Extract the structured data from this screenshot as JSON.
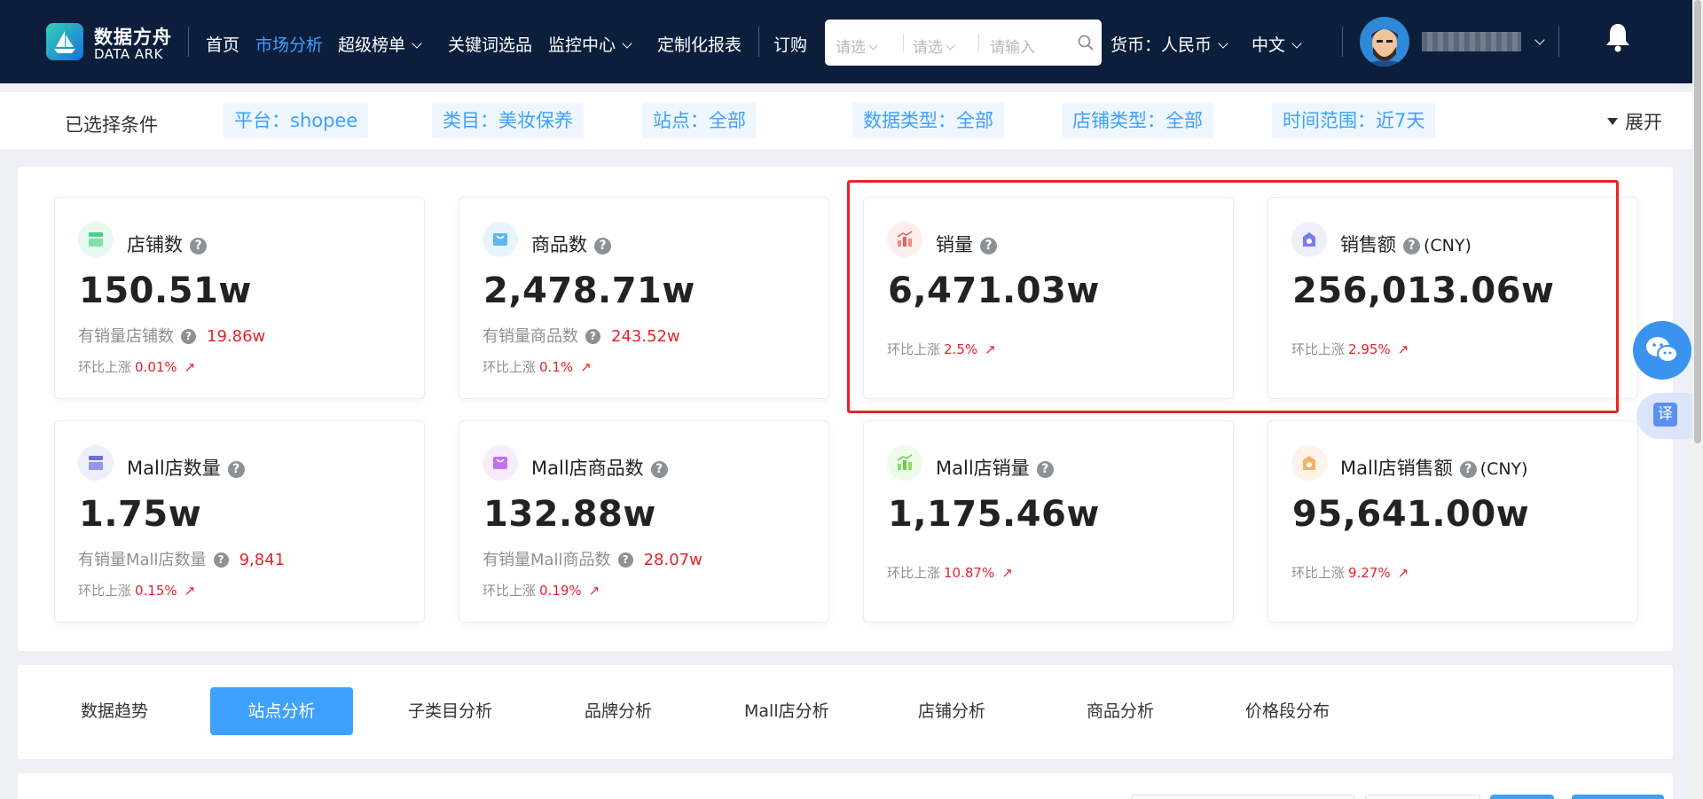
{
  "header": {
    "brand_cn": "数据方舟",
    "brand_en": "DATA ARK",
    "nav": [
      {
        "label": "首页",
        "active": false,
        "dropdown": false
      },
      {
        "label": "市场分析",
        "active": true,
        "dropdown": false
      },
      {
        "label": "超级榜单",
        "active": false,
        "dropdown": true
      },
      {
        "label": "关键词选品",
        "active": false,
        "dropdown": false
      },
      {
        "label": "监控中心",
        "active": false,
        "dropdown": true
      },
      {
        "label": "定制化报表",
        "active": false,
        "dropdown": false
      },
      {
        "label": "订购",
        "active": false,
        "dropdown": false
      }
    ],
    "search": {
      "select1": "请选",
      "select2": "请选",
      "input_placeholder": "请输入"
    },
    "currency": "货币：人民币",
    "language": "中文"
  },
  "filters": {
    "label": "已选择条件",
    "tags": [
      "平台：shopee",
      "类目：美妆保养",
      "站点：全部",
      "数据类型：全部",
      "店铺类型：全部",
      "时间范围：近7天"
    ],
    "expand": "展开"
  },
  "cards": [
    {
      "title": "店铺数",
      "unit": "",
      "value": "150.51w",
      "sub_label": "有销量店铺数",
      "sub_value": "19.86w",
      "change_label": "环比上涨",
      "change_value": "0.01%",
      "icon": "store-icon"
    },
    {
      "title": "商品数",
      "unit": "",
      "value": "2,478.71w",
      "sub_label": "有销量商品数",
      "sub_value": "243.52w",
      "change_label": "环比上涨",
      "change_value": "0.1%",
      "icon": "bag-icon"
    },
    {
      "title": "销量",
      "unit": "",
      "value": "6,471.03w",
      "sub_label": "",
      "sub_value": "",
      "change_label": "环比上涨",
      "change_value": "2.5%",
      "icon": "bar-chart-icon"
    },
    {
      "title": "销售额",
      "unit": "(CNY)",
      "value": "256,013.06w",
      "sub_label": "",
      "sub_value": "",
      "change_label": "环比上涨",
      "change_value": "2.95%",
      "icon": "money-icon"
    },
    {
      "title": "Mall店数量",
      "unit": "",
      "value": "1.75w",
      "sub_label": "有销量Mall店数量",
      "sub_value": "9,841",
      "change_label": "环比上涨",
      "change_value": "0.15%",
      "icon": "mall-store-icon"
    },
    {
      "title": "Mall店商品数",
      "unit": "",
      "value": "132.88w",
      "sub_label": "有销量Mall商品数",
      "sub_value": "28.07w",
      "change_label": "环比上涨",
      "change_value": "0.19%",
      "icon": "mall-bag-icon"
    },
    {
      "title": "Mall店销量",
      "unit": "",
      "value": "1,175.46w",
      "sub_label": "",
      "sub_value": "",
      "change_label": "环比上涨",
      "change_value": "10.87%",
      "icon": "mall-bar-chart-icon"
    },
    {
      "title": "Mall店销售额",
      "unit": "(CNY)",
      "value": "95,641.00w",
      "sub_label": "",
      "sub_value": "",
      "change_label": "环比上涨",
      "change_value": "9.27%",
      "icon": "mall-money-icon"
    }
  ],
  "tabs": [
    "数据趋势",
    "站点分析",
    "子类目分析",
    "品牌分析",
    "Mall店分析",
    "店铺分析",
    "商品分析",
    "价格段分布"
  ],
  "active_tab": "站点分析",
  "side": {
    "translate_label": "译"
  },
  "colors": {
    "header_bg": "#0b1f3c",
    "accent": "#3ea0ff",
    "rise": "#e8222a",
    "highlight": "#e82424"
  }
}
